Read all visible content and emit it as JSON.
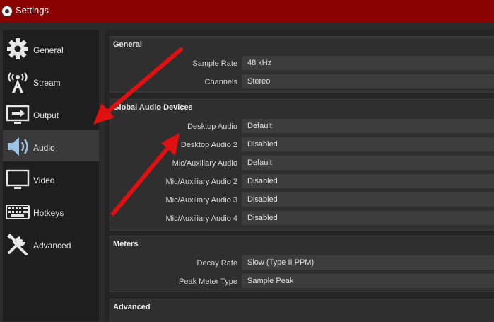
{
  "window": {
    "title": "Settings"
  },
  "sidebar": {
    "items": [
      {
        "label": "General",
        "icon": "gear-icon"
      },
      {
        "label": "Stream",
        "icon": "antenna-icon"
      },
      {
        "label": "Output",
        "icon": "monitor-arrow-icon"
      },
      {
        "label": "Audio",
        "icon": "speaker-icon",
        "selected": true
      },
      {
        "label": "Video",
        "icon": "monitor-icon"
      },
      {
        "label": "Hotkeys",
        "icon": "keyboard-icon"
      },
      {
        "label": "Advanced",
        "icon": "tools-icon"
      }
    ]
  },
  "general": {
    "title": "General",
    "rows": [
      {
        "label": "Sample Rate",
        "value": "48 kHz"
      },
      {
        "label": "Channels",
        "value": "Stereo"
      }
    ]
  },
  "global_audio": {
    "title": "Global Audio Devices",
    "rows": [
      {
        "label": "Desktop Audio",
        "value": "Default"
      },
      {
        "label": "Desktop Audio 2",
        "value": "Disabled"
      },
      {
        "label": "Mic/Auxiliary Audio",
        "value": "Default"
      },
      {
        "label": "Mic/Auxiliary Audio 2",
        "value": "Disabled"
      },
      {
        "label": "Mic/Auxiliary Audio 3",
        "value": "Disabled"
      },
      {
        "label": "Mic/Auxiliary Audio 4",
        "value": "Disabled"
      }
    ]
  },
  "meters": {
    "title": "Meters",
    "rows": [
      {
        "label": "Decay Rate",
        "value": "Slow (Type II PPM)"
      },
      {
        "label": "Peak Meter Type",
        "value": "Sample Peak"
      }
    ]
  },
  "advanced": {
    "title": "Advanced"
  },
  "colors": {
    "titlebar": "#8b0000",
    "annotation_arrow": "#e01010",
    "sidebar_bg": "#1e1e1e",
    "selected_bg": "#3a3a3a"
  }
}
